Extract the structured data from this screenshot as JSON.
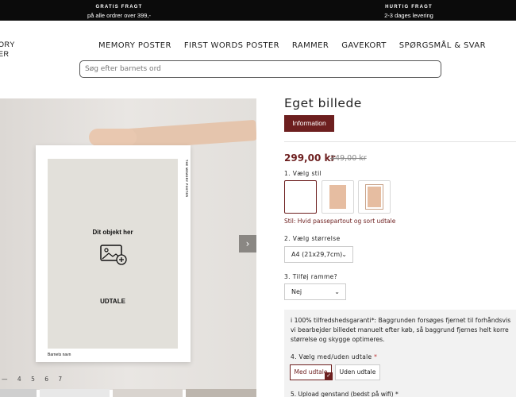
{
  "announcement": {
    "left": {
      "title": "GRATIS FRAGT",
      "sub": "på alle ordrer over 399,-"
    },
    "right": {
      "title": "HURTIG FRAGT",
      "sub": "2-3 dages levering"
    }
  },
  "logo": {
    "line1": "ORY",
    "line2": "ER"
  },
  "nav": {
    "items": [
      "MEMORY POSTER",
      "FIRST WORDS POSTER",
      "RAMMER",
      "GAVEKORT",
      "SPØRGSMÅL & SVAR"
    ]
  },
  "search": {
    "placeholder": "Søg efter barnets ord"
  },
  "gallery": {
    "poster": {
      "object_text": "Dit objekt her",
      "udtale": "UDTALE",
      "brand": "THE MEMORY POSTER",
      "name": "Barnets navn"
    },
    "pager": [
      "4",
      "5",
      "6",
      "7"
    ],
    "next_glyph": "›",
    "first_glyph": "—"
  },
  "product": {
    "title": "Eget billede",
    "info_button": "Information",
    "price": "299,00 kr",
    "old_price": "349,00 kr",
    "style_label": "1. Vælg stil",
    "style_caption": "Stil: Hvid passepartout og sort udtale",
    "size_label": "2. Vælg størrelse",
    "size_value": "A4 (21x29,7cm)",
    "frame_label": "3. Tilføj ramme?",
    "frame_value": "Nej",
    "chevron": "⌄",
    "guarantee_lines": [
      "i 100% tilfredshedsgaranti*: Baggrunden forsøges fjernet til forhåndsvis",
      "vi bearbejder billedet manuelt efter køb, så baggrund fjernes helt korre",
      "størrelse og skygge optimeres."
    ],
    "udtale_label": "4. Vælg med/uden udtale",
    "required_star": "*",
    "udtale_options": [
      "Med udtale",
      "Uden udtale"
    ],
    "check_glyph": "✓",
    "upload_label": "5. Upload genstand (bedst på wifi) *"
  },
  "colors": {
    "accent": "#6d1f1f",
    "topbar": "#0b0b0b"
  }
}
